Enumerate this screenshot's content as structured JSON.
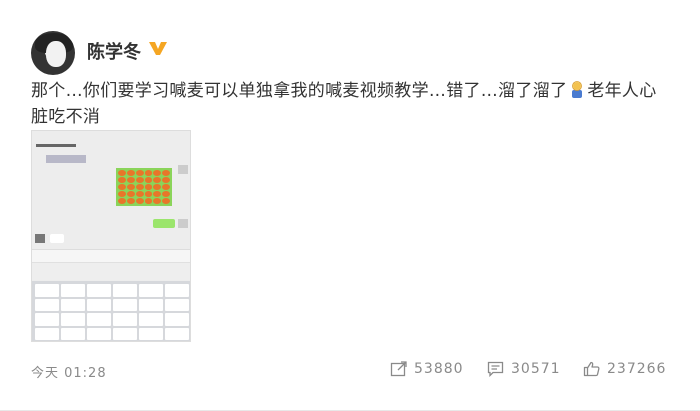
{
  "post": {
    "author": "陈学冬",
    "text_part1": "那个…你们要学习喊麦可以单独拿我的喊麦视频教学…错了…溜了溜了",
    "text_part2": "老年人心脏吃不消",
    "time": "今天 01:28",
    "reposts": "53880",
    "comments": "30571",
    "likes": "237266"
  },
  "icons": {
    "verified": "verified-v-icon",
    "emoji": "person-emoji-icon",
    "repost": "repost-icon",
    "comment": "comment-icon",
    "like": "thumbs-up-icon"
  },
  "colors": {
    "verified": "#f5a623",
    "text": "#333333",
    "muted": "#8a8a8a"
  }
}
